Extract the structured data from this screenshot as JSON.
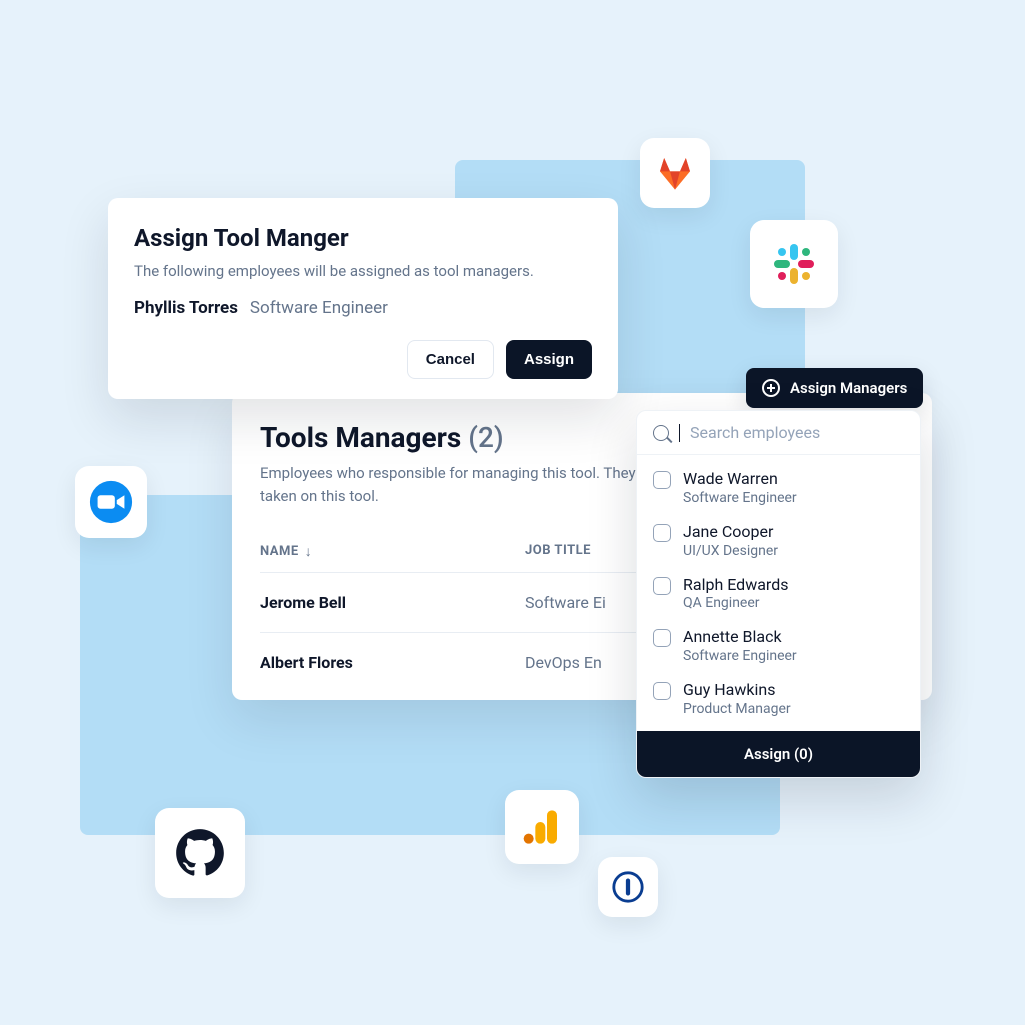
{
  "modal": {
    "title": "Assign Tool Manger",
    "description": "The following employees will be assigned as tool managers.",
    "employee_name": "Phyllis Torres",
    "employee_title": "Software Engineer",
    "cancel_label": "Cancel",
    "assign_label": "Assign"
  },
  "managers_card": {
    "title": "Tools Managers",
    "count_display": "(2)",
    "description_line1": "Employees who responsible for managing this tool. They",
    "description_line2": "taken on this tool.",
    "col_name": "NAME",
    "col_job": "JOB TITLE",
    "rows": [
      {
        "name": "Jerome Bell",
        "title": "Software Ei"
      },
      {
        "name": "Albert Flores",
        "title": "DevOps En"
      }
    ]
  },
  "assign_button_label": "Assign Managers",
  "dropdown": {
    "search_placeholder": "Search employees",
    "items": [
      {
        "name": "Wade Warren",
        "title": "Software Engineer"
      },
      {
        "name": "Jane Cooper",
        "title": "UI/UX Designer"
      },
      {
        "name": "Ralph Edwards",
        "title": "QA Engineer"
      },
      {
        "name": "Annette Black",
        "title": "Software Engineer"
      },
      {
        "name": "Guy Hawkins",
        "title": "Product Manager"
      }
    ],
    "footer_label": "Assign (0)"
  },
  "app_tiles": {
    "gitlab": "gitlab-icon",
    "slack": "slack-icon",
    "zoom": "zoom-icon",
    "github": "github-icon",
    "google_analytics": "google-analytics-icon",
    "onepassword": "onepassword-icon"
  }
}
